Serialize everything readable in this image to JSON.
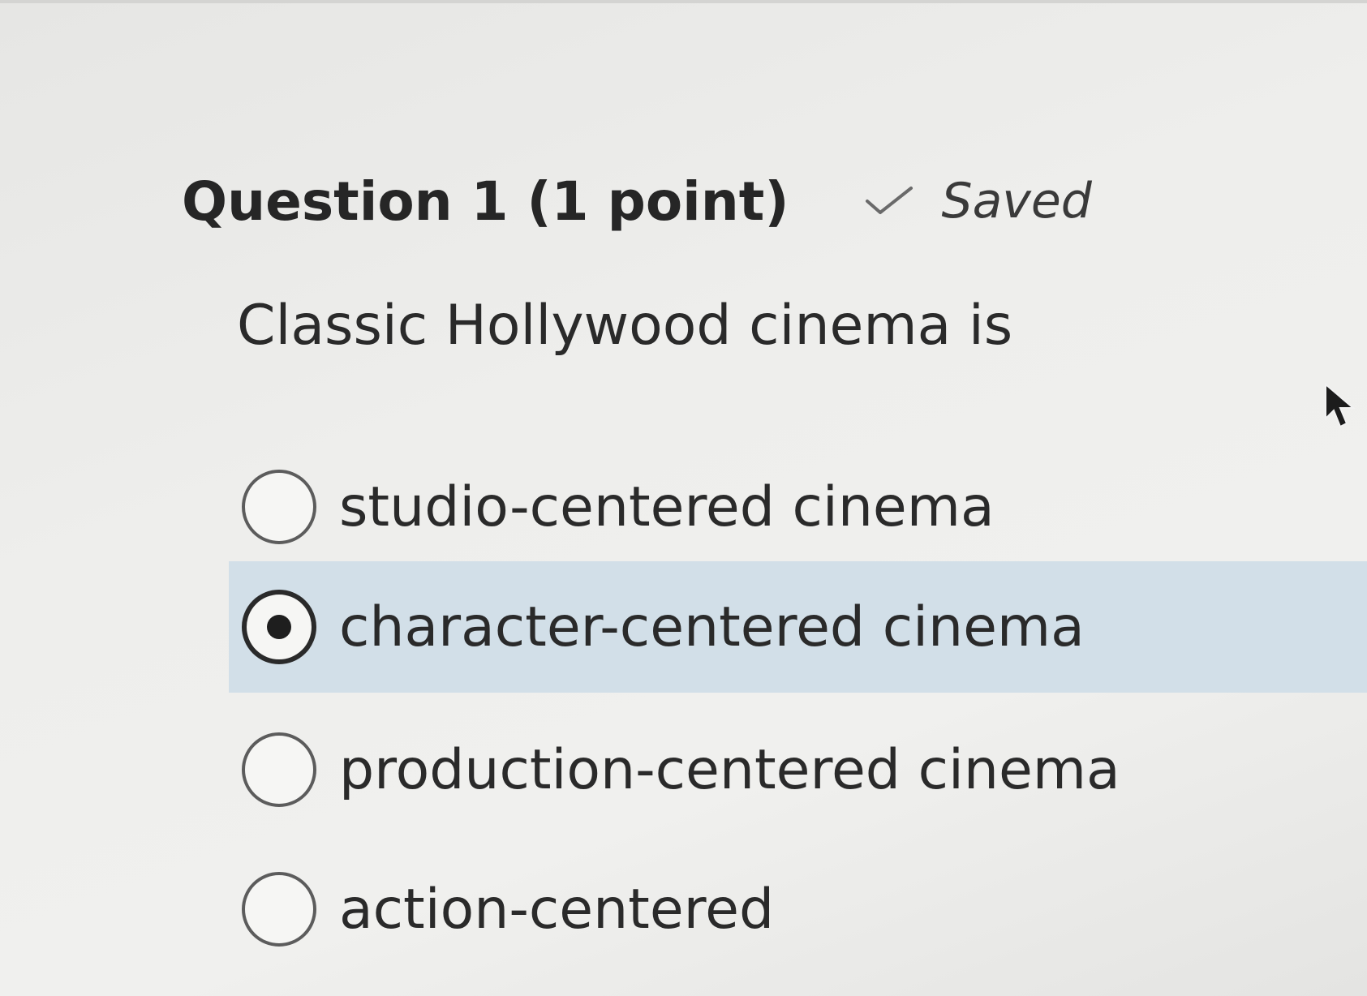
{
  "question": {
    "title": "Question 1 (1 point)",
    "status": "Saved",
    "status_icon": "checkmark-icon",
    "prompt": "Classic Hollywood cinema is"
  },
  "options": [
    {
      "label": "studio-centered cinema",
      "selected": false
    },
    {
      "label": "character-centered cinema",
      "selected": true
    },
    {
      "label": "production-centered cinema",
      "selected": false
    },
    {
      "label": "action-centered",
      "selected": false
    }
  ],
  "colors": {
    "selected_highlight": "#d2dfe8",
    "text": "#2a2a2a",
    "background": "#eeeeec"
  }
}
